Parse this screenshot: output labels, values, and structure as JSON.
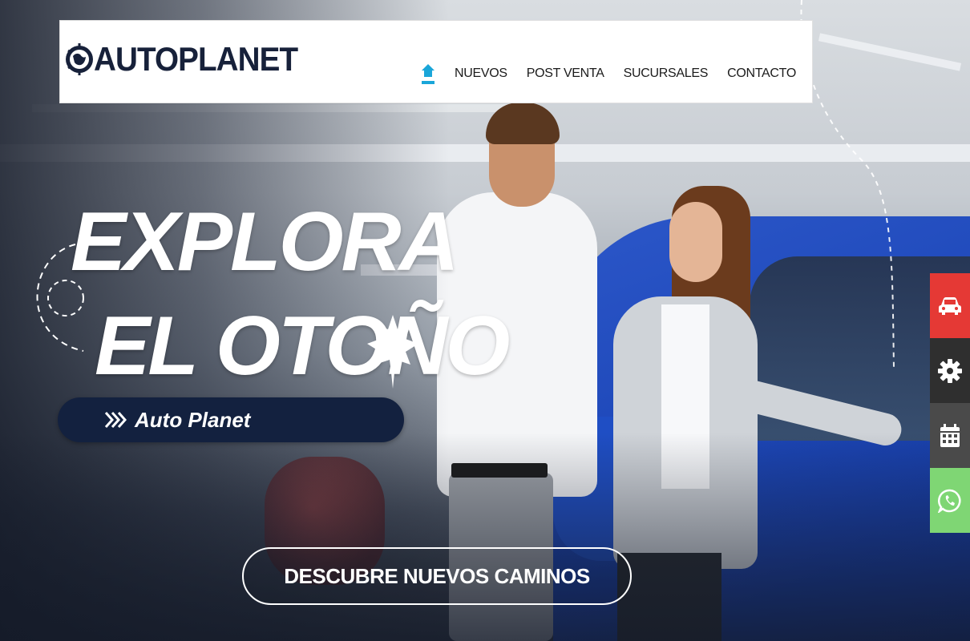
{
  "brand": {
    "logo_text": "AUTOPLANET"
  },
  "nav": {
    "items": [
      {
        "label": "NUEVOS"
      },
      {
        "label": "POST VENTA"
      },
      {
        "label": "SUCURSALES"
      },
      {
        "label": "CONTACTO"
      }
    ],
    "home_icon": "home-icon"
  },
  "hero": {
    "headline_line1": "EXPLORA",
    "headline_line2": "EL OTOÑO",
    "brand_pill": "Auto Planet",
    "cta": "DESCUBRE NUEVOS CAMINOS"
  },
  "side_actions": [
    {
      "icon": "car-icon",
      "color": "#e53935"
    },
    {
      "icon": "gear-icon",
      "color": "#2f2f2f"
    },
    {
      "icon": "calendar-icon",
      "color": "#4a4a4a"
    },
    {
      "icon": "whatsapp-icon",
      "color": "#7fd674"
    }
  ],
  "colors": {
    "accent": "#1aa6d9",
    "navy": "#13213f"
  }
}
